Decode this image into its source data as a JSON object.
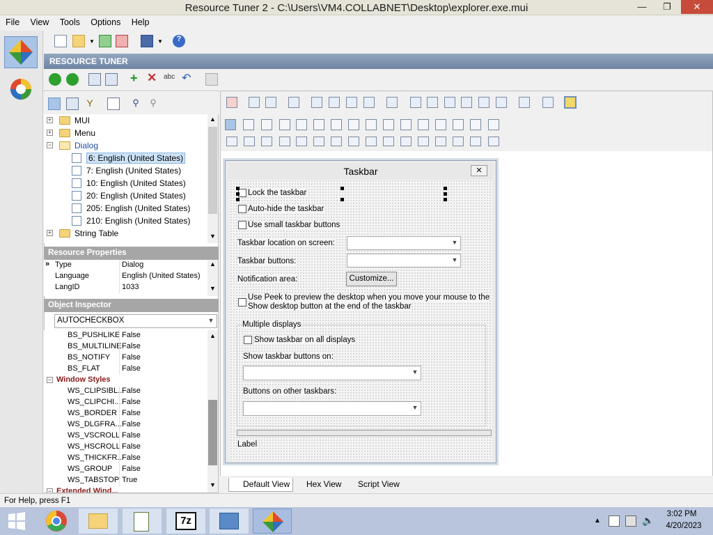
{
  "window": {
    "title": "Resource Tuner 2 - C:\\Users\\VM4.COLLABNET\\Desktop\\explorer.exe.mui",
    "min": "—",
    "max": "❐",
    "close": "✕"
  },
  "menu": [
    "File",
    "View",
    "Tools",
    "Options",
    "Help"
  ],
  "header": {
    "title": "RESOURCE TUNER"
  },
  "tree": {
    "items": [
      {
        "label": "MUI",
        "level": 0,
        "expander": "+"
      },
      {
        "label": "Menu",
        "level": 0,
        "expander": "+"
      },
      {
        "label": "Dialog",
        "level": 0,
        "expander": "−"
      },
      {
        "label": "6: English (United States)",
        "level": 1,
        "selected": true
      },
      {
        "label": "7: English (United States)",
        "level": 1
      },
      {
        "label": "10: English (United States)",
        "level": 1
      },
      {
        "label": "20: English (United States)",
        "level": 1
      },
      {
        "label": "205: English (United States)",
        "level": 1
      },
      {
        "label": "210: English (United States)",
        "level": 1
      },
      {
        "label": "String Table",
        "level": 0,
        "expander": "+"
      }
    ]
  },
  "resource_properties": {
    "title": "Resource Properties",
    "rows": [
      {
        "key": "Type",
        "value": "Dialog"
      },
      {
        "key": "Language",
        "value": "English (United States)"
      },
      {
        "key": "LangID",
        "value": "1033"
      }
    ]
  },
  "object_inspector": {
    "title": "Object Inspector",
    "selected": "AUTOCHECKBOX",
    "rows": [
      {
        "key": "BS_PUSHLIKE",
        "value": "False"
      },
      {
        "key": "BS_MULTILINE",
        "value": "False"
      },
      {
        "key": "BS_NOTIFY",
        "value": "False"
      },
      {
        "key": "BS_FLAT",
        "value": "False"
      },
      {
        "key": "Window Styles",
        "value": "",
        "group": true
      },
      {
        "key": "WS_CLIPSIBL...",
        "value": "False"
      },
      {
        "key": "WS_CLIPCHI...",
        "value": "False"
      },
      {
        "key": "WS_BORDER",
        "value": "False"
      },
      {
        "key": "WS_DLGFRA...",
        "value": "False"
      },
      {
        "key": "WS_VSCROLL",
        "value": "False"
      },
      {
        "key": "WS_HSCROLL",
        "value": "False"
      },
      {
        "key": "WS_THICKFR...",
        "value": "False"
      },
      {
        "key": "WS_GROUP",
        "value": "False"
      },
      {
        "key": "WS_TABSTOP",
        "value": "True"
      },
      {
        "key": "Extended Wind...",
        "value": "",
        "group": true
      }
    ]
  },
  "dialog": {
    "title": "Taskbar",
    "close": "✕",
    "lock": "Lock the taskbar",
    "autohide": "Auto-hide the taskbar",
    "small": "Use small taskbar buttons",
    "location": "Taskbar location on screen:",
    "buttons": "Taskbar buttons:",
    "notification": "Notification area:",
    "customize": "Customize...",
    "peek1": "Use Peek to preview the desktop when you move your mouse to the",
    "peek2": "Show desktop button at the end of the taskbar",
    "multi": "Multiple displays",
    "showall": "Show taskbar on all displays",
    "showon": "Show taskbar buttons on:",
    "other": "Buttons on other taskbars:",
    "label": "Label"
  },
  "view_tabs": [
    "Default View",
    "Hex View",
    "Script View"
  ],
  "status": "For Help, press F1",
  "clock": {
    "time": "3:02 PM",
    "date": "4/20/2023"
  },
  "colors": {
    "accent": "#6f84a3",
    "group_red": "#8b1a1a",
    "selected_tree": "#cde3f7"
  }
}
